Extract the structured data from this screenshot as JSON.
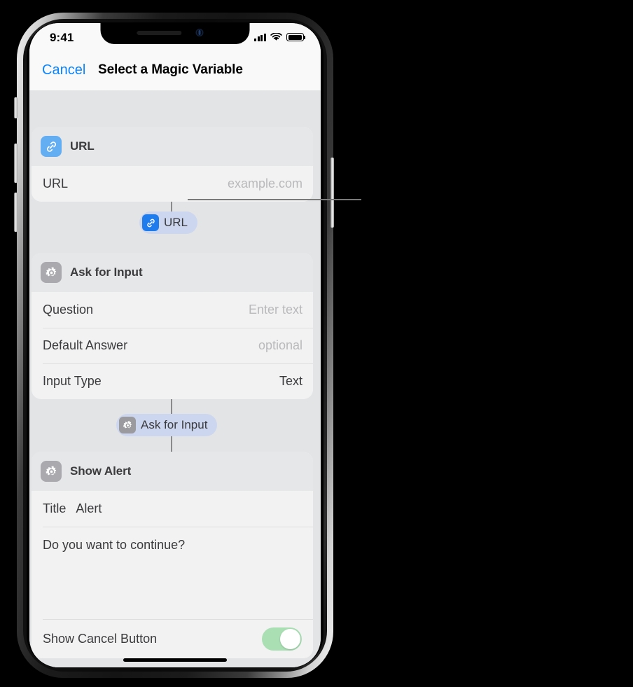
{
  "status_bar": {
    "time": "9:41",
    "signal_icon": "cellular-bars-icon",
    "wifi_icon": "wifi-icon",
    "battery_icon": "battery-full-icon"
  },
  "nav_bar": {
    "cancel_label": "Cancel",
    "title": "Select a Magic Variable"
  },
  "colors": {
    "accent_blue": "#0a84ff",
    "chip_background": "#ccd6ef",
    "url_icon_blue": "#63aef3",
    "gear_icon_gray": "#a9a9ae",
    "toggle_on_green": "#a9dfb3",
    "canvas_background": "#e3e4e6",
    "card_background": "#f2f2f3",
    "card_header_background": "#e6e7e9"
  },
  "cards": [
    {
      "id": "url-action",
      "icon": "link-icon",
      "icon_style": "blue",
      "title": "URL",
      "rows": [
        {
          "label": "URL",
          "value": "example.com",
          "value_style": "placeholder"
        }
      ]
    },
    {
      "id": "ask-for-input-action",
      "icon": "gear-icon",
      "icon_style": "gray",
      "title": "Ask for Input",
      "rows": [
        {
          "label": "Question",
          "value": "Enter text",
          "value_style": "placeholder"
        },
        {
          "label": "Default Answer",
          "value": "optional",
          "value_style": "placeholder"
        },
        {
          "label": "Input Type",
          "value": "Text",
          "value_style": "normal"
        }
      ]
    },
    {
      "id": "show-alert-action",
      "icon": "gear-icon",
      "icon_style": "gray",
      "title": "Show Alert",
      "rows": [
        {
          "label": "Title",
          "value": "Alert",
          "value_style": "inline"
        }
      ],
      "message_text": "Do you want to continue?",
      "toggle": {
        "label": "Show Cancel Button",
        "state": "on"
      }
    }
  ],
  "magic_variable_chips": [
    {
      "id": "url-chip",
      "icon": "link-icon",
      "icon_style": "blue",
      "label": "URL",
      "selected": true
    },
    {
      "id": "ask-for-input-chip",
      "icon": "gear-icon",
      "icon_style": "gray",
      "label": "Ask for Input",
      "selected": false
    }
  ],
  "callout": {
    "target": "url-chip",
    "description": "leader line pointing to the URL magic variable"
  }
}
